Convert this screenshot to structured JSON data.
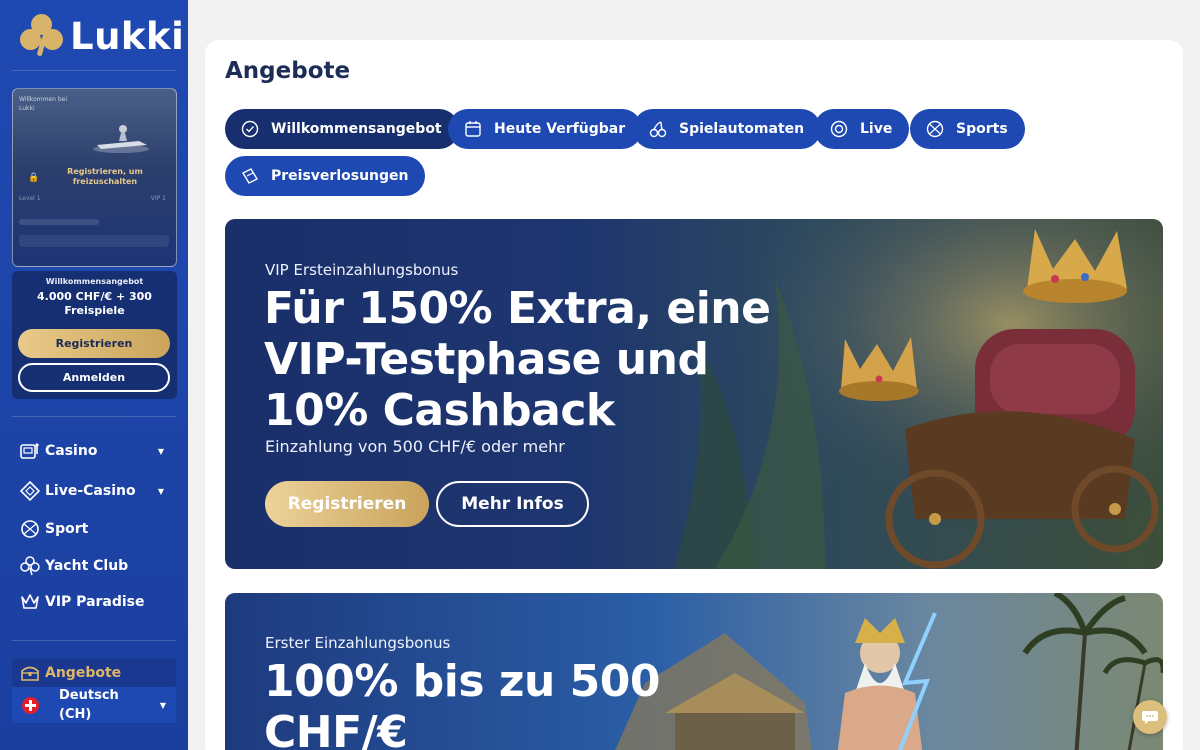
{
  "brand": {
    "name": "Lukki",
    "gold": "#d8b46a",
    "blue": "#1f49b2"
  },
  "sidebar": {
    "preview": {
      "title": "Willkommen bei Lukki",
      "unlock_text": "Registrieren, um freizuschalten",
      "level_left": "Level 1",
      "level_right": "VIP 1"
    },
    "welcome": {
      "label": "Willkommensangebot",
      "offer_line1": "4.000 CHF/€ + 300",
      "offer_line2": "Freispiele",
      "register": "Registrieren",
      "login": "Anmelden"
    },
    "nav": [
      {
        "label": "Casino",
        "icon": "slot-machine-icon",
        "has_caret": true
      },
      {
        "label": "Live-Casino",
        "icon": "diamond-card-icon",
        "has_caret": true
      },
      {
        "label": "Sport",
        "icon": "ball-icon",
        "has_caret": false
      },
      {
        "label": "Yacht Club",
        "icon": "clover-icon",
        "has_caret": false
      },
      {
        "label": "VIP Paradise",
        "icon": "crown-icon",
        "has_caret": false
      }
    ],
    "active_item": {
      "label": "Angebote",
      "icon": "treasure-chest-icon"
    },
    "language": {
      "label": "Deutsch (CH)",
      "flag": "swiss-flag-icon"
    }
  },
  "main": {
    "title": "Angebote",
    "tabs": [
      {
        "label": "Willkommensangebot",
        "icon": "check-badge-icon",
        "active": true
      },
      {
        "label": "Heute Verfügbar",
        "icon": "calendar-icon",
        "active": false
      },
      {
        "label": "Spielautomaten",
        "icon": "cherries-icon",
        "active": false
      },
      {
        "label": "Live",
        "icon": "chip-icon",
        "active": false
      },
      {
        "label": "Sports",
        "icon": "ball-icon",
        "active": false
      },
      {
        "label": "Preisverlosungen",
        "icon": "ticket-icon",
        "active": false
      }
    ],
    "banners": [
      {
        "kicker": "VIP Ersteinzahlungsbonus",
        "headline": [
          "Für 150% Extra, eine",
          "VIP-Testphase und",
          "10% Cashback"
        ],
        "sub": "Einzahlung von 500 CHF/€ oder mehr",
        "primary": "Registrieren",
        "secondary": "Mehr Infos"
      },
      {
        "kicker": "Erster Einzahlungsbonus",
        "headline": [
          "100% bis zu 500",
          "CHF/€"
        ]
      }
    ]
  },
  "chat": {
    "icon": "chat-bubble-icon"
  }
}
